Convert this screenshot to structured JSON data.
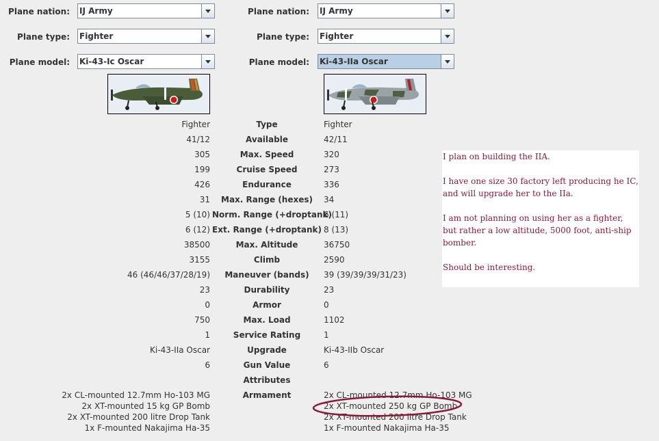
{
  "left": {
    "nation_label": "Plane nation:",
    "nation_value": "IJ Army",
    "type_label": "Plane type:",
    "type_value": "Fighter",
    "model_label": "Plane model:",
    "model_value": "Ki-43-Ic Oscar"
  },
  "right": {
    "nation_label": "Plane nation:",
    "nation_value": "IJ Army",
    "type_label": "Plane type:",
    "type_value": "Fighter",
    "model_label": "Plane model:",
    "model_value": "Ki-43-IIa Oscar"
  },
  "stats": [
    {
      "label": "Type",
      "left": "Fighter",
      "right": "Fighter"
    },
    {
      "label": "Available",
      "left": "41/12",
      "right": "42/11"
    },
    {
      "label": "Max. Speed",
      "left": "305",
      "right": "320"
    },
    {
      "label": "Cruise Speed",
      "left": "199",
      "right": "273"
    },
    {
      "label": "Endurance",
      "left": "426",
      "right": "336"
    },
    {
      "label": "Max. Range (hexes)",
      "left": "31",
      "right": "34"
    },
    {
      "label": "Norm. Range (+droptank)",
      "left": "5 (10)",
      "right": "6 (11)"
    },
    {
      "label": "Ext. Range (+droptank)",
      "left": "6 (12)",
      "right": "8 (13)"
    },
    {
      "label": "Max. Altitude",
      "left": "38500",
      "right": "36750"
    },
    {
      "label": "Climb",
      "left": "3155",
      "right": "2590"
    },
    {
      "label": "Maneuver (bands)",
      "left": "46 (46/46/37/28/19)",
      "right": "39 (39/39/39/31/23)"
    },
    {
      "label": "Durability",
      "left": "23",
      "right": "23"
    },
    {
      "label": "Armor",
      "left": "0",
      "right": "0"
    },
    {
      "label": "Max. Load",
      "left": "750",
      "right": "1102"
    },
    {
      "label": "Service Rating",
      "left": "1",
      "right": "1"
    },
    {
      "label": "Upgrade",
      "left": "Ki-43-IIa Oscar",
      "right": "Ki-43-IIb Oscar"
    },
    {
      "label": "Gun Value",
      "left": "6",
      "right": "6"
    },
    {
      "label": "Attributes",
      "left": "",
      "right": ""
    },
    {
      "label": "Armament",
      "left": "",
      "right": ""
    }
  ],
  "armament": {
    "left": [
      "2x CL-mounted 12.7mm Ho-103 MG",
      "2x XT-mounted 15 kg GP Bomb",
      "2x XT-mounted 200 litre Drop Tank",
      "1x F-mounted Nakajima Ha-35"
    ],
    "right": [
      "2x CL-mounted 12.7mm Ho-103 MG",
      "2x XT-mounted 250 kg GP Bomb",
      "2x XT-mounted 200 litre Drop Tank",
      "1x F-mounted Nakajima Ha-35"
    ]
  },
  "note": {
    "p1": "I plan on building the IIA.",
    "p2": "I have one size 30 factory left producing he IC, and will upgrade her to the IIa.",
    "p3": "I am not planning on using her as a fighter, but rather a low altitude, 5000 foot,  anti-ship bomber.",
    "p4": "Should be interesting."
  },
  "colors": {
    "background": "#eeeeee",
    "note_text": "#8b1a3a",
    "circle": "#8b1a3a",
    "combo_selected": "#b8cfe5"
  }
}
